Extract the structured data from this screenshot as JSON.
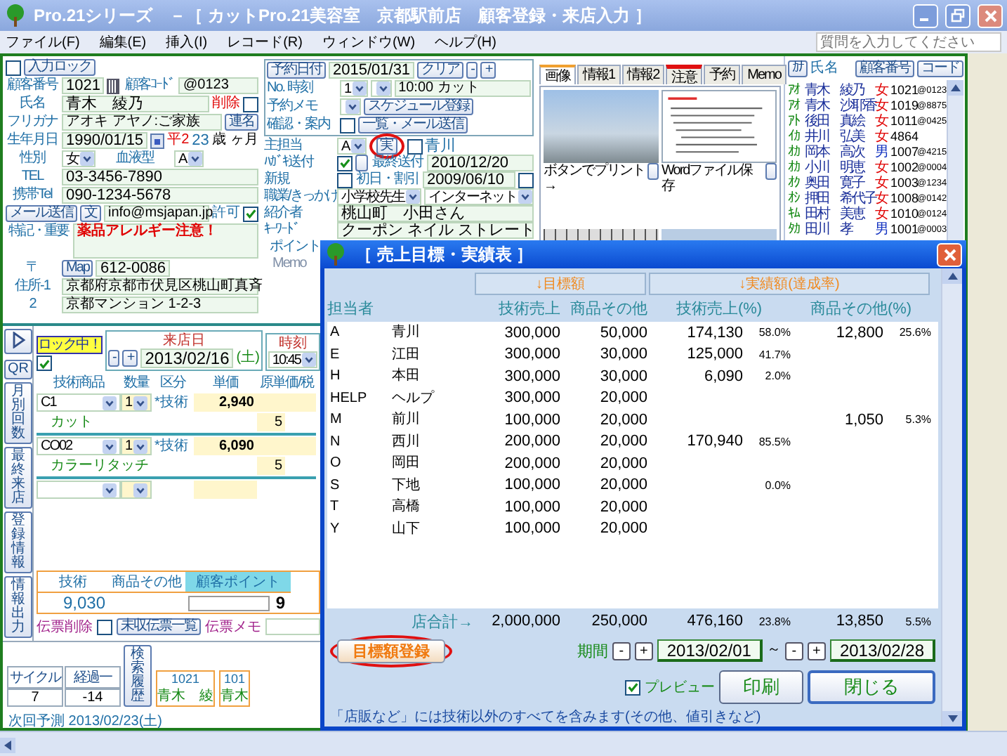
{
  "window": {
    "title": "Pro.21シリーズ　－［ カットPro.21美容室　京都駅前店　顧客登録・来店入力 ］"
  },
  "menu": [
    "ファイル(F)",
    "編集(E)",
    "挿入(I)",
    "レコード(R)",
    "ウィンドウ(W)",
    "ヘルプ(H)"
  ],
  "help_search": {
    "placeholder": "質問を入力してください"
  },
  "customer": {
    "input_lock": {
      "label": "入力ロック",
      "checked": false
    },
    "number": {
      "label": "顧客番号",
      "value": "1021"
    },
    "code": {
      "label": "顧客ｺｰﾄﾞ",
      "value": "@0123"
    },
    "name": {
      "label": "氏名",
      "value": "青木　綾乃"
    },
    "delete": {
      "label": "削除",
      "checked": false
    },
    "furigana": {
      "label": "フリガナ",
      "value": "アオキ アヤノ:ご家族",
      "button": "連名"
    },
    "birthday": {
      "label": "生年月日",
      "value": "1990/01/15",
      "era": "平2",
      "age": "23",
      "age_unit": "歳",
      "month_unit": "ヶ月"
    },
    "gender": {
      "label": "性別",
      "value": "女"
    },
    "blood": {
      "label": "血液型",
      "value": "A"
    },
    "tel": {
      "label": "TEL",
      "value": "03-3456-7890"
    },
    "mobile": {
      "label": "携帯Tel",
      "value": "090-1234-5678"
    },
    "mail": {
      "send_button": "メール送信",
      "text_button": "文",
      "value": "info@msjapan.jp",
      "permit_label": "許可",
      "permit_checked": true
    },
    "notes": {
      "label": "特記・重要",
      "value": "薬品アレルギー注意！"
    },
    "zip": {
      "label": "〒",
      "map_button": "Map",
      "value": "612-0086"
    },
    "address1": {
      "label": "住所-1",
      "value": "京都府京都市伏見区桃山町真斉"
    },
    "address2": {
      "label": "2",
      "value": "京都マンション 1-2-3"
    }
  },
  "reservation": {
    "date_button": "予約日付",
    "date": "2015/01/31",
    "clear_button": "クリア",
    "minus": "-",
    "plus": "+",
    "no_time_label": "No. 時刻",
    "no": "1",
    "time_memo": "10:00 カット",
    "memo_label": "予約メモ",
    "schedule_button": "スケジュール登録",
    "confirm_label": "確認・案内",
    "confirm_checked": false,
    "mail_button": "一覧・メール送信"
  },
  "profile": {
    "staff": {
      "label": "主担当",
      "value": "A",
      "button": "実",
      "highlighted": true,
      "checked": false,
      "name": "青川"
    },
    "postcard": {
      "label": "ﾊｶﾞｷ送付",
      "checked": true,
      "last_label": "最終送付",
      "last": "2010/12/20"
    },
    "new": {
      "label": "新規",
      "checked": false,
      "first_label": "初日・割引",
      "first": "2009/06/10",
      "first_checked": false
    },
    "job": {
      "label": "職業/きっかけ",
      "value": "小学校先生",
      "trigger": "インターネット"
    },
    "referrer": {
      "label": "紹介者",
      "value": "桃山町　小田さん"
    },
    "keywords": {
      "label": "ｷｰﾜｰﾄﾞ",
      "value": "クーポン ネイル ストレート"
    },
    "point_label": "ポイント",
    "memo_label": "Memo"
  },
  "tabs": [
    {
      "label": "画像",
      "selected": true,
      "flagged": false
    },
    {
      "label": "情報1",
      "selected": false,
      "flagged": false
    },
    {
      "label": "情報2",
      "selected": false,
      "flagged": false
    },
    {
      "label": "注意",
      "selected": false,
      "flagged": true
    },
    {
      "label": "予約",
      "selected": false,
      "flagged": false
    },
    {
      "label": "Memo",
      "selected": false,
      "flagged": false
    }
  ],
  "images": {
    "print_caption": "ボタンでプリント　→",
    "word_caption": "Wordファイル保存"
  },
  "customer_list": {
    "kana_button": "ｶﾅ",
    "name_header": "氏名",
    "number_button": "顧客番号",
    "code_button": "コード",
    "rows": [
      {
        "kana": "ｱｵ",
        "name": "青木　綾乃",
        "gender": "女",
        "color": "#e00000",
        "number": "1021",
        "code": "@0123"
      },
      {
        "kana": "ｱｵ",
        "name": "青木　沙耶香",
        "gender": "女",
        "color": "#e00000",
        "number": "1019",
        "code": "@8875"
      },
      {
        "kana": "ｱﾄ",
        "name": "後田　真絵",
        "gender": "女",
        "color": "#e00000",
        "number": "1011",
        "code": "@0425"
      },
      {
        "kana": "ｲｶ",
        "name": "井川　弘美",
        "gender": "女",
        "color": "#e00000",
        "number": "4864"
      },
      {
        "kana": "ｵｶ",
        "name": "岡本　高次",
        "gender": "男",
        "color": "#1030c0",
        "number": "1007",
        "code": "@4215"
      },
      {
        "kana": "ｵｶ",
        "name": "小川　明恵",
        "gender": "女",
        "color": "#e00000",
        "number": "1002",
        "code": "@0004"
      },
      {
        "kana": "ｵｸ",
        "name": "奥田　寛子",
        "gender": "女",
        "color": "#e00000",
        "number": "1003",
        "code": "@1234"
      },
      {
        "kana": "ｵｼ",
        "name": "押田　希代子",
        "gender": "女",
        "color": "#e00000",
        "number": "1008",
        "code": "@0142"
      },
      {
        "kana": "ｷﾑ",
        "name": "田村　美恵",
        "gender": "女",
        "color": "#e00000",
        "number": "1010",
        "code": "@0124"
      },
      {
        "kana": "ﾀｶ",
        "name": "田川　孝",
        "gender": "男",
        "color": "#1030c0",
        "number": "1001",
        "code": "@0003"
      }
    ]
  },
  "visit": {
    "lock_label": "ロック中！",
    "lock_checked": true,
    "date_label": "来店日",
    "minus": "-",
    "plus": "+",
    "date": "2013/02/16",
    "weekday": "(土)",
    "time_label": "時刻",
    "time": "10:45",
    "columns": [
      "技術商品",
      "数量",
      "区分",
      "単価",
      "原単価/税"
    ],
    "items": [
      {
        "code": "C1",
        "qty": "1",
        "category": "*技術",
        "price": "2,940",
        "name": "カット",
        "tax": "5"
      },
      {
        "code": "CO02",
        "qty": "1",
        "category": "*技術",
        "price": "6,090",
        "name": "カラーリタッチ",
        "tax": "5"
      }
    ],
    "side_buttons": [
      "QR",
      "月別回数",
      "最終来店",
      "登録情報",
      "情報出力"
    ],
    "totals": {
      "tech_label": "技術",
      "tech": "9,030",
      "other_label": "商品その他",
      "points_label": "顧客ポイント",
      "points": "9"
    },
    "slip_delete_label": "伝票削除",
    "slip_delete_checked": false,
    "unpaid_button": "未収伝票一覧",
    "memo_label": "伝票メモ",
    "next": {
      "label": "次回予測",
      "value": "2013/02/23(土)",
      "cycle_label": "サイクル",
      "cycle": "7",
      "elapsed_label": "経過一",
      "elapsed": "-14",
      "history_button": "検索履歴",
      "history": [
        {
          "number": "1021",
          "name": "青木　綾"
        },
        {
          "number": "101",
          "name": "青木"
        }
      ]
    }
  },
  "dialog": {
    "title": "［ 売上目標・実績表 ］",
    "target_group": "↓目標額",
    "actual_group": "↓実績額(達成率)",
    "columns": [
      "担当者",
      "技術売上",
      "商品その他",
      "技術売上(%)",
      "商品その他(%)"
    ],
    "rows": [
      {
        "code": "A",
        "name": "青川",
        "target_tech": "300,000",
        "target_other": "50,000",
        "actual_tech": "174,130",
        "tech_pct": "58.0%",
        "actual_other": "12,800",
        "other_pct": "25.6%"
      },
      {
        "code": "E",
        "name": "江田",
        "target_tech": "300,000",
        "target_other": "30,000",
        "actual_tech": "125,000",
        "tech_pct": "41.7%"
      },
      {
        "code": "H",
        "name": "本田",
        "target_tech": "300,000",
        "target_other": "30,000",
        "actual_tech": "6,090",
        "tech_pct": "2.0%"
      },
      {
        "code": "HELP",
        "name": "ヘルプ",
        "target_tech": "300,000",
        "target_other": "20,000"
      },
      {
        "code": "M",
        "name": "前川",
        "target_tech": "100,000",
        "target_other": "20,000",
        "actual_other": "1,050",
        "other_pct": "5.3%"
      },
      {
        "code": "N",
        "name": "西川",
        "target_tech": "200,000",
        "target_other": "20,000",
        "actual_tech": "170,940",
        "tech_pct": "85.5%"
      },
      {
        "code": "O",
        "name": "岡田",
        "target_tech": "200,000",
        "target_other": "20,000"
      },
      {
        "code": "S",
        "name": "下地",
        "target_tech": "100,000",
        "target_other": "20,000",
        "tech_pct": "0.0%"
      },
      {
        "code": "T",
        "name": "高橋",
        "target_tech": "100,000",
        "target_other": "20,000"
      },
      {
        "code": "Y",
        "name": "山下",
        "target_tech": "100,000",
        "target_other": "20,000"
      }
    ],
    "total": {
      "label": "店合計→",
      "target_tech": "2,000,000",
      "target_other": "250,000",
      "actual_tech": "476,160",
      "tech_pct": "23.8%",
      "actual_other": "13,850",
      "other_pct": "5.5%"
    },
    "register_button": "目標額登録",
    "register_highlighted": true,
    "period_label": "期間",
    "minus": "-",
    "plus": "+",
    "from": "2013/02/01",
    "tilde": "～",
    "to": "2013/02/28",
    "preview_label": "プレビュー",
    "preview_checked": true,
    "print_button": "印刷",
    "close_button": "閉じる",
    "note": "「店販など」には技術以外のすべてを含みます(その他、値引きなど)"
  }
}
